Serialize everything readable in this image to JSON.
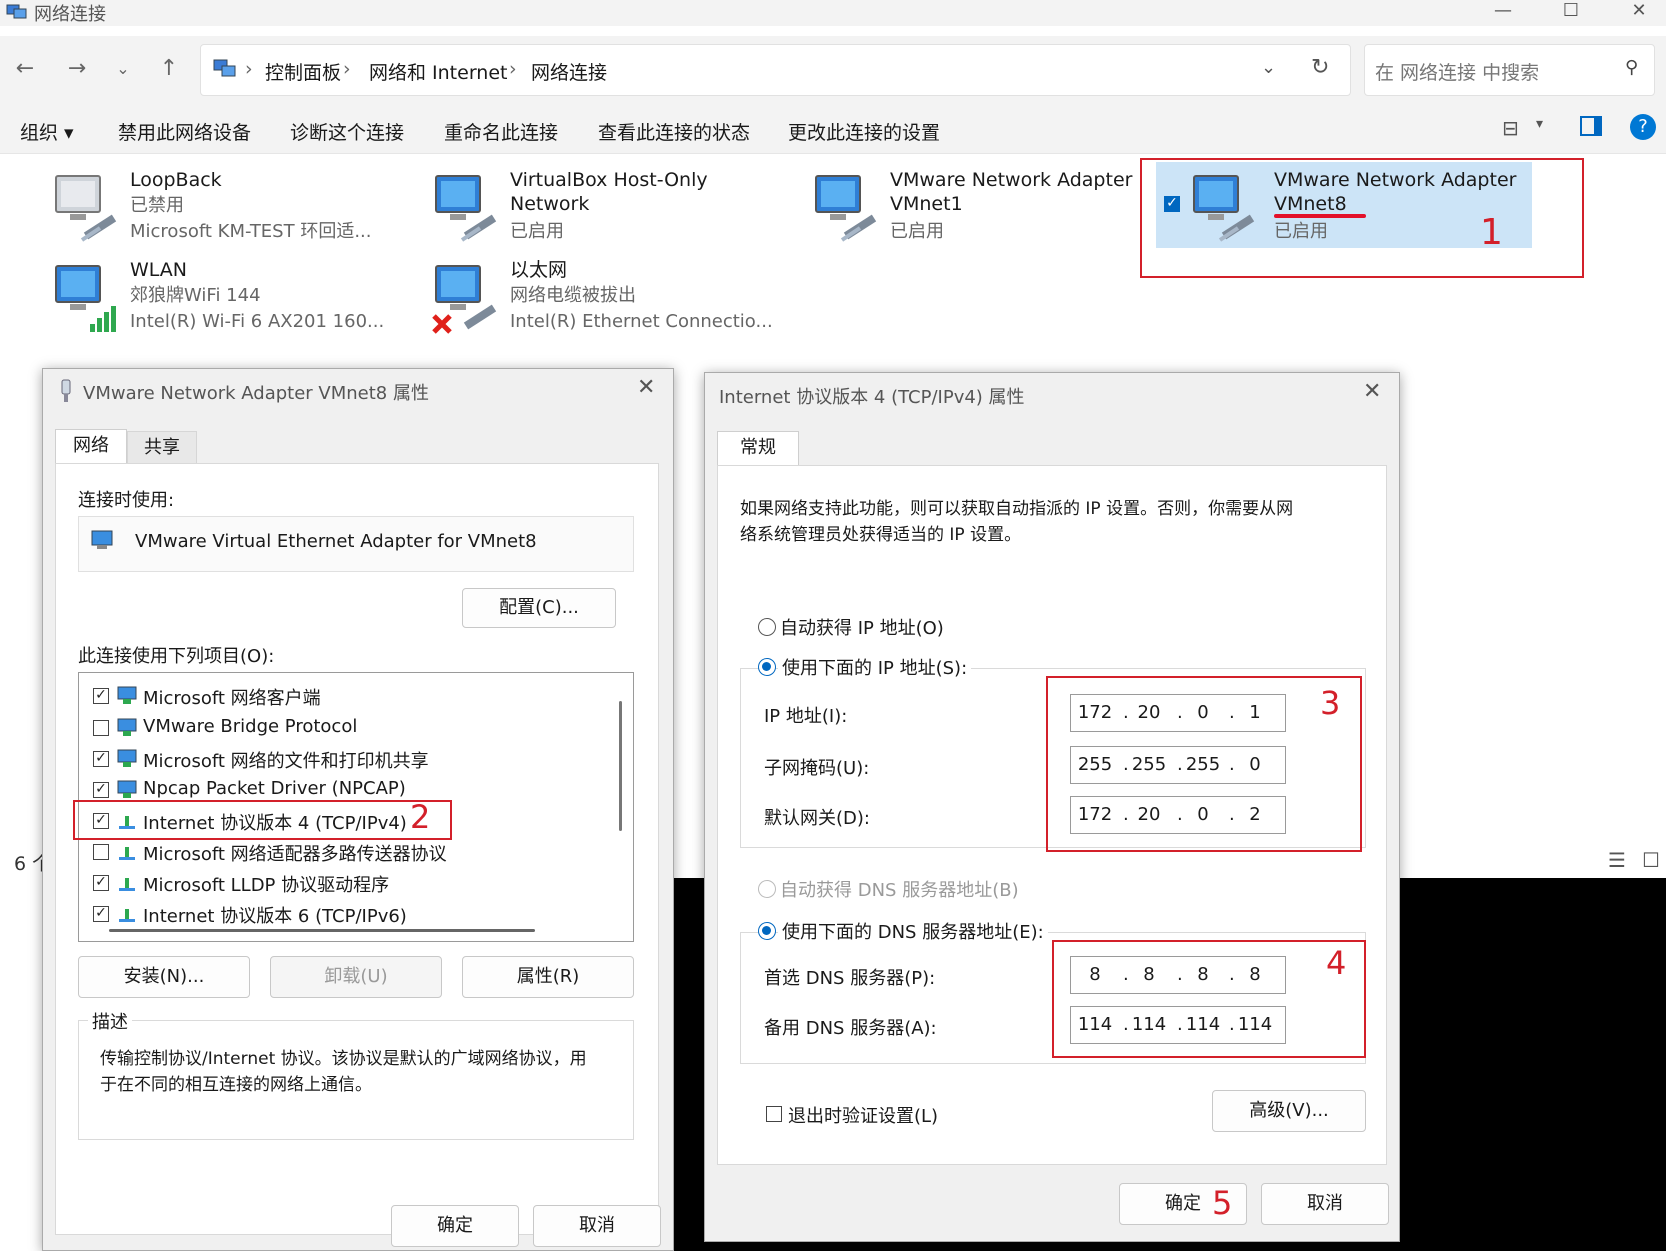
{
  "explorer": {
    "title": "网络连接",
    "window_controls": {
      "minimize": "—",
      "maximize": "☐",
      "close": "✕"
    },
    "breadcrumb": [
      "控制面板",
      "网络和 Internet",
      "网络连接"
    ],
    "search_placeholder": "在 网络连接 中搜索",
    "commands": [
      "组织",
      "禁用此网络设备",
      "诊断这个连接",
      "重命名此连接",
      "查看此连接的状态",
      "更改此连接的设置"
    ],
    "status_count": "6 个",
    "adapters": [
      {
        "name": "LoopBack",
        "status": "已禁用",
        "device": "Microsoft KM-TEST 环回适..."
      },
      {
        "name_line1": "VirtualBox Host-Only",
        "name_line2": "Network",
        "status": "已启用"
      },
      {
        "name_line1": "VMware Network Adapter",
        "name_line2": "VMnet1",
        "status": "已启用"
      },
      {
        "name_line1": "VMware Network Adapter",
        "name_line2": "VMnet8",
        "status": "已启用",
        "selected": true
      },
      {
        "name": "WLAN",
        "status": "郊狼牌WiFi 144",
        "device": "Intel(R) Wi-Fi 6 AX201 160..."
      },
      {
        "name": "以太网",
        "status": "网络电缆被拔出",
        "device": "Intel(R) Ethernet Connectio..."
      }
    ]
  },
  "annotations": [
    "1",
    "2",
    "3",
    "4",
    "5"
  ],
  "adapter_dialog": {
    "title": "VMware Network Adapter VMnet8 属性",
    "tabs": [
      "网络",
      "共享"
    ],
    "connect_using_label": "连接时使用:",
    "adapter_name": "VMware Virtual Ethernet Adapter for VMnet8",
    "configure_button": "配置(C)...",
    "items_label": "此连接使用下列项目(O):",
    "items": [
      {
        "checked": true,
        "label": "Microsoft 网络客户端"
      },
      {
        "checked": false,
        "label": "VMware Bridge Protocol"
      },
      {
        "checked": true,
        "label": "Microsoft 网络的文件和打印机共享"
      },
      {
        "checked": true,
        "label": "Npcap Packet Driver (NPCAP)"
      },
      {
        "checked": true,
        "label": "Internet 协议版本 4 (TCP/IPv4)"
      },
      {
        "checked": false,
        "label": "Microsoft 网络适配器多路传送器协议"
      },
      {
        "checked": true,
        "label": "Microsoft LLDP 协议驱动程序"
      },
      {
        "checked": true,
        "label": "Internet 协议版本 6 (TCP/IPv6)"
      }
    ],
    "install_button": "安装(N)...",
    "uninstall_button": "卸载(U)",
    "properties_button": "属性(R)",
    "description_label": "描述",
    "description_text_line1": "传输控制协议/Internet 协议。该协议是默认的广域网络协议，用",
    "description_text_line2": "于在不同的相互连接的网络上通信。",
    "ok_button": "确定",
    "cancel_button": "取消"
  },
  "ipv4_dialog": {
    "title": "Internet 协议版本 4 (TCP/IPv4) 属性",
    "tab": "常规",
    "intro_line1": "如果网络支持此功能，则可以获取自动指派的 IP 设置。否则，你需要从网",
    "intro_line2": "络系统管理员处获得适当的 IP 设置。",
    "auto_ip": "自动获得 IP 地址(O)",
    "manual_ip": "使用下面的 IP 地址(S):",
    "ip_label": "IP 地址(I):",
    "ip": [
      "172",
      "20",
      "0",
      "1"
    ],
    "mask_label": "子网掩码(U):",
    "mask": [
      "255",
      "255",
      "255",
      "0"
    ],
    "gateway_label": "默认网关(D):",
    "gateway": [
      "172",
      "20",
      "0",
      "2"
    ],
    "auto_dns": "自动获得 DNS 服务器地址(B)",
    "manual_dns": "使用下面的 DNS 服务器地址(E):",
    "dns1_label": "首选 DNS 服务器(P):",
    "dns1": [
      "8",
      "8",
      "8",
      "8"
    ],
    "dns2_label": "备用 DNS 服务器(A):",
    "dns2": [
      "114",
      "114",
      "114",
      "114"
    ],
    "validate_label": "退出时验证设置(L)",
    "advanced_button": "高级(V)...",
    "ok_button": "确定",
    "cancel_button": "取消"
  },
  "colors": {
    "accent": "#0067c0",
    "annotation_red": "#d3202a",
    "selection": "#cce4f7"
  }
}
